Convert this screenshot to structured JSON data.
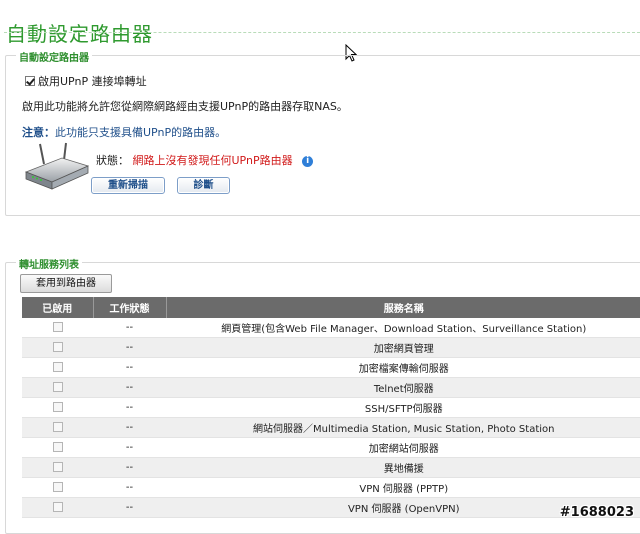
{
  "page": {
    "title": "自動設定路由器"
  },
  "router_group": {
    "legend": "自動設定路由器",
    "enable_upnp_label": "啟用UPnP 連接埠轉址",
    "enable_upnp_checked": true,
    "description": "啟用此功能將允許您從網際網路經由支援UPnP的路由器存取NAS。",
    "note_label": "注意：",
    "note_text": "此功能只支援具備UPnP的路由器。",
    "status_label": "狀態：",
    "status_value": "網路上沒有發現任何UPnP路由器",
    "rescan_label": "重新掃描",
    "diagnose_label": "診斷"
  },
  "service_group": {
    "legend": "轉址服務列表",
    "apply_label": "套用到路由器",
    "columns": [
      "已啟用",
      "工作狀態",
      "服務名稱"
    ],
    "rows": [
      {
        "status": "--",
        "name": "網頁管理(包含Web File Manager、Download Station、Surveillance Station)"
      },
      {
        "status": "--",
        "name": "加密網頁管理"
      },
      {
        "status": "--",
        "name": "加密檔案傳輸伺服器"
      },
      {
        "status": "--",
        "name": "Telnet伺服器"
      },
      {
        "status": "--",
        "name": "SSH/SFTP伺服器"
      },
      {
        "status": "--",
        "name": "網站伺服器／Multimedia Station, Music Station, Photo Station"
      },
      {
        "status": "--",
        "name": "加密網站伺服器"
      },
      {
        "status": "--",
        "name": "異地備援"
      },
      {
        "status": "--",
        "name": "VPN 伺服器 (PPTP)"
      },
      {
        "status": "--",
        "name": "VPN 伺服器 (OpenVPN)"
      }
    ]
  },
  "watermark": "#1688023",
  "colors": {
    "title_green": "#2f9a2f",
    "status_red": "#d11a1a",
    "header_gray": "#6b6b6b"
  }
}
